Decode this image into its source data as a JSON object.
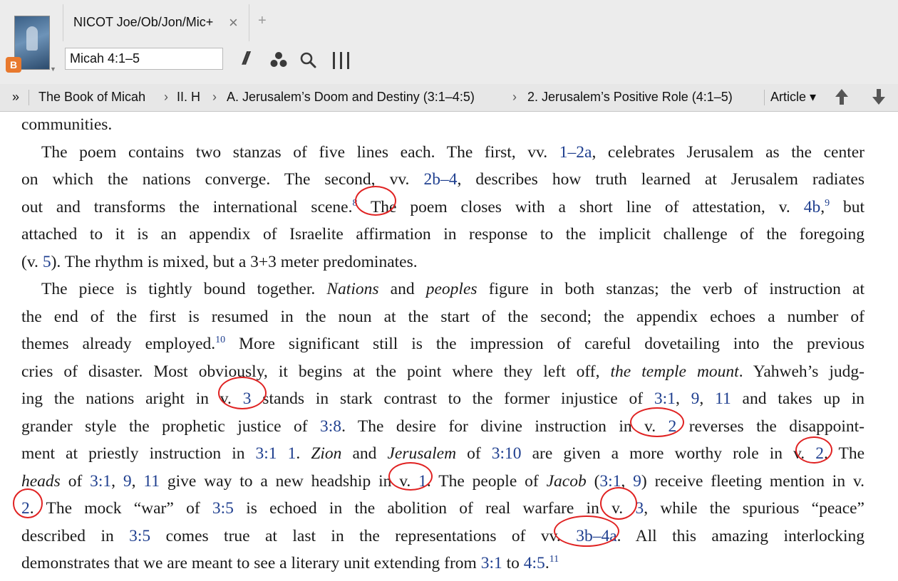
{
  "tab": {
    "title": "NICOT Joe/Ob/Jon/Mic+",
    "close": "×",
    "add": "+"
  },
  "badge": "B",
  "reference": "Micah 4:1–5",
  "breadcrumb": {
    "expand": "»",
    "items": [
      "The Book of Micah",
      "II. H",
      "A. Jerusalem’s Doom and Destiny (3:1–4:5)",
      "2. Jerusalem’s Positive Role (4:1–5)"
    ],
    "separator": "›",
    "type_menu": "Article ▾"
  },
  "icons": [
    "parallel-icon",
    "visual-filter-icon",
    "search-icon",
    "columns-icon",
    "prev-arrow-icon",
    "next-arrow-icon"
  ],
  "colors": {
    "link": "#1f3f8f",
    "annotation": "#e02222",
    "badge": "#e8792e"
  },
  "lines": [
    {
      "segments": [
        {
          "t": "communities."
        }
      ]
    },
    {
      "segments": [
        {
          "t": "The poem contains two stanzas of five lines each. The first, vv. "
        },
        {
          "t": "1–2a",
          "link": true
        },
        {
          "t": ", celebrates Jerusalem as the center"
        }
      ]
    },
    {
      "segments": [
        {
          "t": "on which the nations converge. The second, vv. "
        },
        {
          "t": "2b–4",
          "link": true
        },
        {
          "t": ", describes how truth learned at Jerusalem radiates"
        }
      ]
    },
    {
      "segments": [
        {
          "t": "out and transforms the international scene."
        },
        {
          "t": "8",
          "fn": true
        },
        {
          "t": " The poem closes with a short line of attestation, v. "
        },
        {
          "t": "4b",
          "link": true
        },
        {
          "t": ","
        },
        {
          "t": "9",
          "fn": true
        },
        {
          "t": " but"
        }
      ]
    },
    {
      "segments": [
        {
          "t": "attached to it is an appendix of Israelite affirmation in response to the implicit challenge of the foregoing"
        }
      ]
    },
    {
      "segments": [
        {
          "t": "(v. "
        },
        {
          "t": "5",
          "link": true
        },
        {
          "t": "). The rhythm is mixed, but a 3+3 meter predominates."
        }
      ]
    },
    {
      "segments": [
        {
          "t": "The piece is tightly bound together. "
        },
        {
          "t": "Nations",
          "em": true
        },
        {
          "t": " and "
        },
        {
          "t": "peoples",
          "em": true
        },
        {
          "t": " figure in both stanzas; the verb of instruction at"
        }
      ]
    },
    {
      "segments": [
        {
          "t": "the end of the first is resumed in the noun at the start of the second; the appendix echoes a number of"
        }
      ]
    },
    {
      "segments": [
        {
          "t": "themes already employed."
        },
        {
          "t": "10",
          "fn": true
        },
        {
          "t": " More significant still is the impression of careful dovetailing into the previous"
        }
      ]
    },
    {
      "segments": [
        {
          "t": "cries of disaster. Most obviously, it begins at the point where they left off, "
        },
        {
          "t": "the temple mount",
          "em": true
        },
        {
          "t": ". Yahweh’s judg-"
        }
      ]
    },
    {
      "segments": [
        {
          "t": "ing the nations aright in v. "
        },
        {
          "t": "3",
          "link": true
        },
        {
          "t": " stands in stark contrast to the former injustice of "
        },
        {
          "t": "3:1",
          "link": true
        },
        {
          "t": ", "
        },
        {
          "t": "9",
          "link": true
        },
        {
          "t": ", "
        },
        {
          "t": "11",
          "link": true
        },
        {
          "t": " and takes up in"
        }
      ]
    },
    {
      "segments": [
        {
          "t": "grander style the prophetic justice of "
        },
        {
          "t": "3:8",
          "link": true
        },
        {
          "t": ". The desire for divine instruction in v. "
        },
        {
          "t": "2",
          "link": true
        },
        {
          "t": " reverses the disappoint-"
        }
      ]
    },
    {
      "segments": [
        {
          "t": "ment at priestly instruction in "
        },
        {
          "t": "3:1",
          "link": true
        },
        {
          "t": " "
        },
        {
          "t": "1",
          "link": true
        },
        {
          "t": ". "
        },
        {
          "t": "Zion",
          "em": true
        },
        {
          "t": " and "
        },
        {
          "t": "Jerusalem",
          "em": true
        },
        {
          "t": " of "
        },
        {
          "t": "3:10",
          "link": true
        },
        {
          "t": " are given a more worthy role in v. "
        },
        {
          "t": "2",
          "link": true
        },
        {
          "t": ". The"
        }
      ]
    },
    {
      "segments": [
        {
          "t": "heads",
          "em": true
        },
        {
          "t": " of "
        },
        {
          "t": "3:1",
          "link": true
        },
        {
          "t": ", "
        },
        {
          "t": "9",
          "link": true
        },
        {
          "t": ", "
        },
        {
          "t": "11",
          "link": true
        },
        {
          "t": " give way to a new headship in v. "
        },
        {
          "t": "1",
          "link": true
        },
        {
          "t": ". The people of "
        },
        {
          "t": "Jacob",
          "em": true
        },
        {
          "t": " ("
        },
        {
          "t": "3:1",
          "link": true
        },
        {
          "t": ", "
        },
        {
          "t": "9",
          "link": true
        },
        {
          "t": ") receive fleeting mention in v."
        }
      ]
    },
    {
      "segments": [
        {
          "t": "2",
          "link": true
        },
        {
          "t": ". The mock “war” of "
        },
        {
          "t": "3:5",
          "link": true
        },
        {
          "t": " is echoed in the abolition of real warfare in v. "
        },
        {
          "t": "3",
          "link": true
        },
        {
          "t": ", while the spurious “peace”"
        }
      ]
    },
    {
      "segments": [
        {
          "t": "described in "
        },
        {
          "t": "3:5",
          "link": true
        },
        {
          "t": " comes true at last in the representations of vv. "
        },
        {
          "t": "3b–4a",
          "link": true
        },
        {
          "t": ". All this amazing interlocking"
        }
      ]
    },
    {
      "segments": [
        {
          "t": "demonstrates that we are meant to see a literary unit extending from "
        },
        {
          "t": "3:1",
          "link": true
        },
        {
          "t": " to "
        },
        {
          "t": "4:5",
          "link": true
        },
        {
          "t": "."
        },
        {
          "t": "11",
          "fn": true
        }
      ]
    }
  ]
}
